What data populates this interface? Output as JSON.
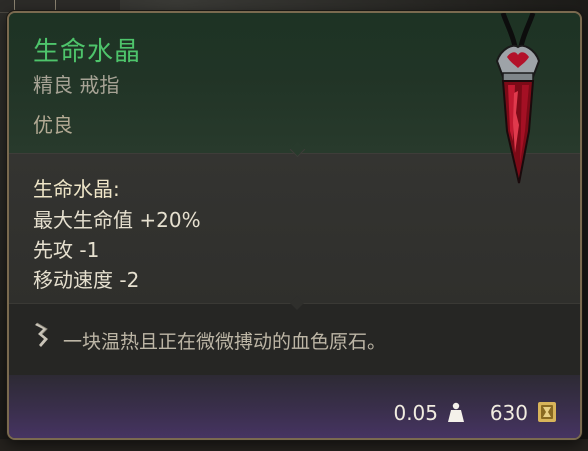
{
  "item": {
    "name": "生命水晶",
    "subtitle": "精良 戒指",
    "rarity": "优良"
  },
  "stats": {
    "header": "生命水晶:",
    "lines": [
      "最大生命值 +20%",
      "先攻 -1",
      "移动速度 -2"
    ]
  },
  "description": "一块温热且正在微微搏动的血色原石。",
  "footer": {
    "weight": "0.05",
    "price": "630"
  },
  "icons": {
    "description": "feather-quill-icon",
    "weight": "weight-icon",
    "price": "gold-coin-icon",
    "item": "blood-crystal-pendant-icon"
  },
  "colors": {
    "name": "#4ec46b",
    "border": "#7a6a4f"
  }
}
